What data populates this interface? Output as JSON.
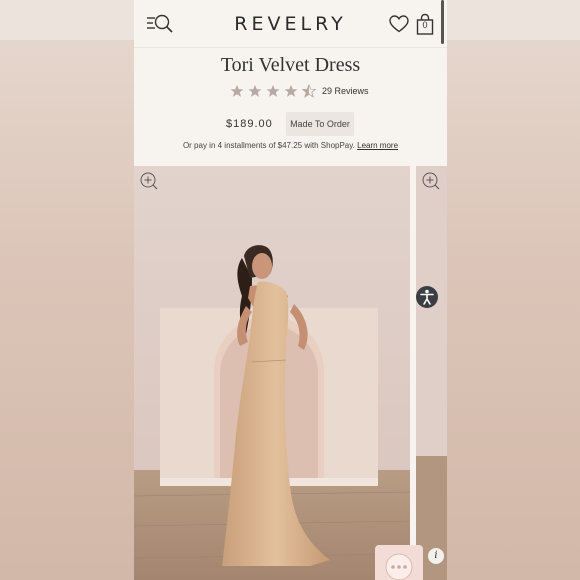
{
  "header": {
    "brand": "REVELRY",
    "bag_count": "0",
    "icons": [
      "menu-search-icon",
      "heart-icon",
      "shopping-bag-icon"
    ]
  },
  "product": {
    "title": "Tori Velvet Dress",
    "rating": 4.5,
    "rating_max": 5,
    "reviews_label": "29 Reviews",
    "price": "$189.00",
    "availability": "Made To Order",
    "installments_text": "Or pay in 4 installments of $47.25 with ShopPay.",
    "learn_more": "Learn more"
  },
  "colors": {
    "star": "#b7aaa2",
    "dress": "#d9b48f",
    "background": "#e5d8cf"
  },
  "widgets": {
    "accessibility": "accessibility-icon",
    "chat": "chat-icon",
    "info_label": "i"
  }
}
